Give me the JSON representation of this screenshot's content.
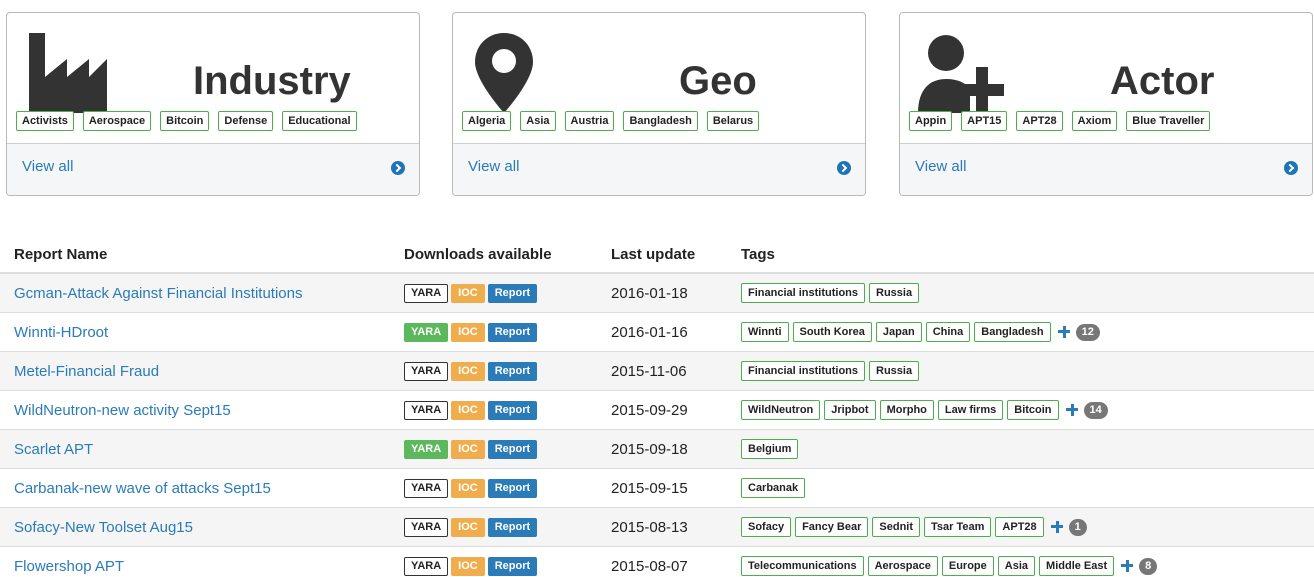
{
  "cards": [
    {
      "id": "industry",
      "title": "Industry",
      "icon": "factory-icon",
      "chips": [
        "Activists",
        "Aerospace",
        "Bitcoin",
        "Defense",
        "Educational"
      ],
      "view_all": "View all"
    },
    {
      "id": "geo",
      "title": "Geo",
      "icon": "map-pin-icon",
      "chips": [
        "Algeria",
        "Asia",
        "Austria",
        "Bangladesh",
        "Belarus"
      ],
      "view_all": "View all"
    },
    {
      "id": "actor",
      "title": "Actor",
      "icon": "user-plus-icon",
      "chips": [
        "Appin",
        "APT15",
        "APT28",
        "Axiom",
        "Blue Traveller"
      ],
      "view_all": "View all"
    }
  ],
  "table": {
    "headers": {
      "name": "Report Name",
      "downloads": "Downloads available",
      "updated": "Last update",
      "tags": "Tags"
    },
    "download_labels": {
      "yara": "YARA",
      "ioc": "IOC",
      "report": "Report"
    },
    "rows": [
      {
        "name": "Gcman-Attack Against Financial Institutions",
        "yara_available": false,
        "date": "2016-01-18",
        "tags": [
          "Financial institutions",
          "Russia"
        ],
        "more": null
      },
      {
        "name": "Winnti-HDroot",
        "yara_available": true,
        "date": "2016-01-16",
        "tags": [
          "Winnti",
          "South Korea",
          "Japan",
          "China",
          "Bangladesh"
        ],
        "more": "12"
      },
      {
        "name": "Metel-Financial Fraud",
        "yara_available": false,
        "date": "2015-11-06",
        "tags": [
          "Financial institutions",
          "Russia"
        ],
        "more": null
      },
      {
        "name": "WildNeutron-new activity Sept15",
        "yara_available": false,
        "date": "2015-09-29",
        "tags": [
          "WildNeutron",
          "Jripbot",
          "Morpho",
          "Law firms",
          "Bitcoin"
        ],
        "more": "14"
      },
      {
        "name": "Scarlet APT",
        "yara_available": true,
        "date": "2015-09-18",
        "tags": [
          "Belgium"
        ],
        "more": null
      },
      {
        "name": "Carbanak-new wave of attacks Sept15",
        "yara_available": false,
        "date": "2015-09-15",
        "tags": [
          "Carbanak"
        ],
        "more": null
      },
      {
        "name": "Sofacy-New Toolset Aug15",
        "yara_available": false,
        "date": "2015-08-13",
        "tags": [
          "Sofacy",
          "Fancy Bear",
          "Sednit",
          "Tsar Team",
          "APT28"
        ],
        "more": "1"
      },
      {
        "name": "Flowershop APT",
        "yara_available": false,
        "date": "2015-08-07",
        "tags": [
          "Telecommunications",
          "Aerospace",
          "Europe",
          "Asia",
          "Middle East"
        ],
        "more": "8"
      }
    ]
  },
  "colors": {
    "link": "#2a7bb8",
    "tag_border": "#4cae4c",
    "yara_on": "#5cb85c",
    "ioc": "#f0ad4e",
    "report": "#2a7bb8",
    "icon": "#333333"
  }
}
